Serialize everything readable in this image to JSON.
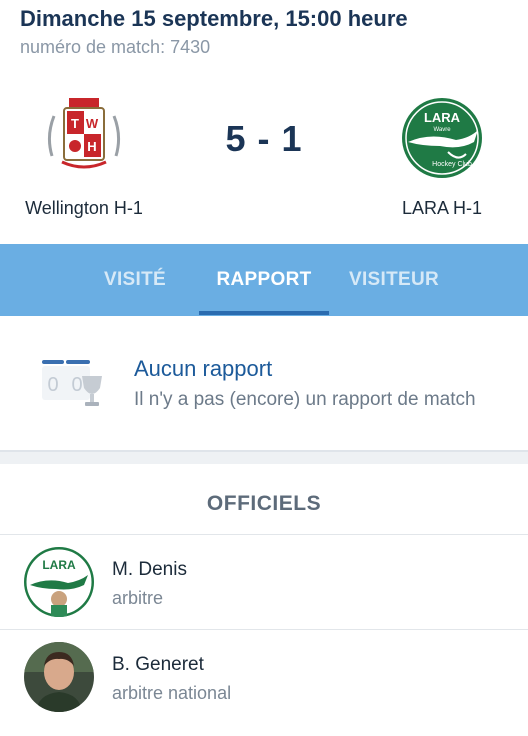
{
  "match": {
    "datetime": "Dimanche 15 septembre, 15:00 heure",
    "number_label": "numéro de match: 7430",
    "score": "5 - 1"
  },
  "home_team": {
    "name": "Wellington H-1",
    "logo_text": "T W H"
  },
  "away_team": {
    "name": "LARA H-1",
    "logo_text_top": "LARA",
    "logo_text_city": "Wavre",
    "logo_text_club": "Hockey Club"
  },
  "tabs": [
    {
      "label": "VISITÉ",
      "active": false
    },
    {
      "label": "RAPPORT",
      "active": true
    },
    {
      "label": "VISITEUR",
      "active": false
    }
  ],
  "report": {
    "title": "Aucun rapport",
    "subtitle": "Il n'y a pas (encore) un rapport de match",
    "icon_score": "0 0"
  },
  "officials": {
    "title": "OFFICIELS",
    "list": [
      {
        "name": "M. Denis",
        "role": "arbitre",
        "avatar": "lara-club-avatar"
      },
      {
        "name": "B. Generet",
        "role": "arbitre national",
        "avatar": "person-photo-avatar"
      }
    ]
  },
  "colors": {
    "tab_bar": "#6aaee3",
    "tab_underline": "#2b6cb0",
    "heading": "#1b3556",
    "report_title": "#1c5a9a",
    "lara_green": "#1f7a45",
    "wellington_red": "#c8262b"
  }
}
